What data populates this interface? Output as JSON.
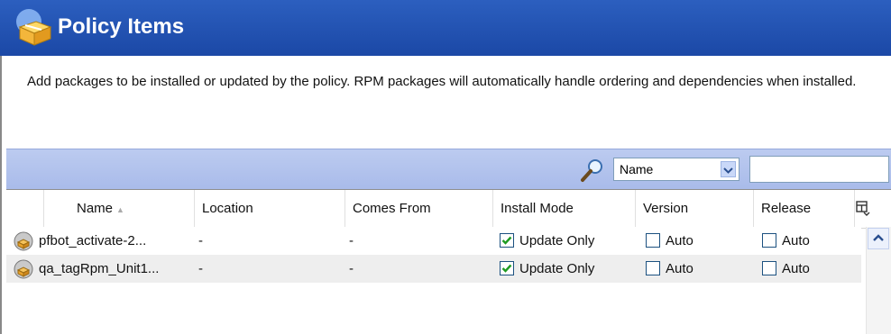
{
  "header": {
    "title": "Policy Items",
    "logo_icon": "package-box-icon"
  },
  "description": "Add packages to be installed or updated by the policy.  RPM packages will automatically handle ordering and dependencies when installed.",
  "filter": {
    "search_icon": "magnifier-icon",
    "field_selected": "Name",
    "text_value": ""
  },
  "table": {
    "columns": [
      "Name",
      "Location",
      "Comes From",
      "Install Mode",
      "Version",
      "Release"
    ],
    "rows": [
      {
        "name": "pfbot_activate-2...",
        "location": "-",
        "comes_from": "-",
        "install_mode": "Update Only",
        "install_checked": true,
        "version": "Auto",
        "version_checked": false,
        "release": "Auto",
        "release_checked": false
      },
      {
        "name": "qa_tagRpm_Unit1...",
        "location": "-",
        "comes_from": "-",
        "install_mode": "Update Only",
        "install_checked": true,
        "version": "Auto",
        "version_checked": false,
        "release": "Auto",
        "release_checked": false
      }
    ]
  },
  "colors": {
    "header_bg": "#1b48a6",
    "filter_bar": "#b3c4ee",
    "row_alt": "#eeeeee",
    "check_green": "#1f9b22"
  }
}
